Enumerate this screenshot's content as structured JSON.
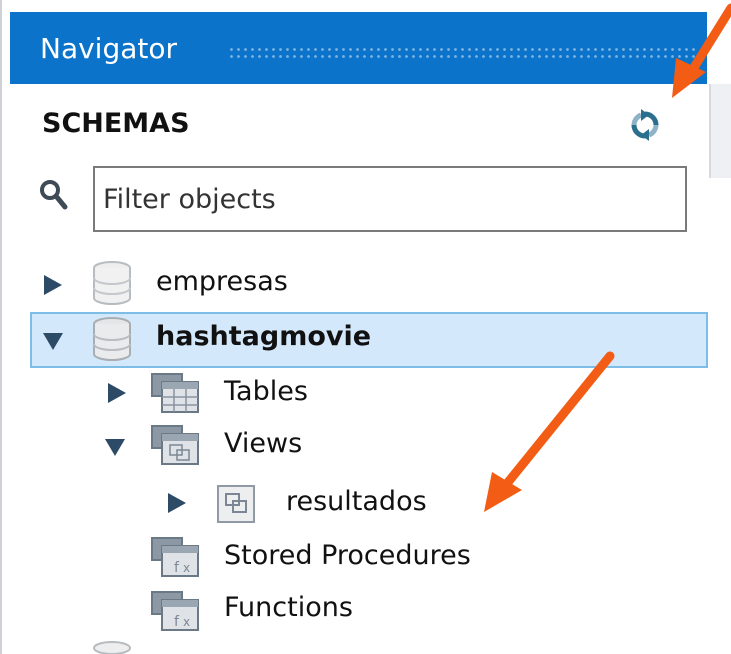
{
  "navigator": {
    "title": "Navigator",
    "section_label": "SCHEMAS",
    "refresh_icon": "refresh-icon",
    "filter": {
      "placeholder": "Filter objects",
      "value": ""
    }
  },
  "tree": {
    "schemas": [
      {
        "label": "empresas",
        "expanded": false,
        "selected": false
      },
      {
        "label": "hashtagmovie",
        "expanded": true,
        "selected": true,
        "children": [
          {
            "label": "Tables",
            "expanded": false
          },
          {
            "label": "Views",
            "expanded": true,
            "children": [
              {
                "label": "resultados",
                "expanded": false
              }
            ]
          },
          {
            "label": "Stored Procedures"
          },
          {
            "label": "Functions"
          }
        ]
      }
    ]
  },
  "annotations": {
    "arrow_color": "#f25c14"
  },
  "colors": {
    "title_bar": "#0b73c9",
    "selection_bg": "#d3e9fb",
    "selection_border": "#7fbde9"
  }
}
